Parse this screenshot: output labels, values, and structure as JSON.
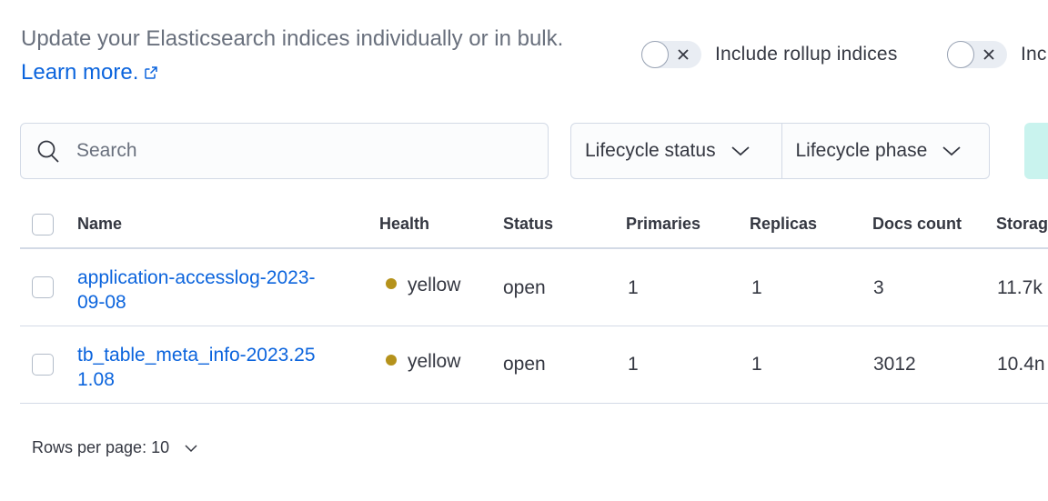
{
  "intro": {
    "text": "Update your Elasticsearch indices individually or in bulk.",
    "learn_more": "Learn more."
  },
  "toggles": [
    {
      "label": "Include rollup indices",
      "checked": false
    },
    {
      "label": "Inc",
      "checked": false
    }
  ],
  "search": {
    "placeholder": "Search",
    "value": ""
  },
  "filters": [
    {
      "label": "Lifecycle status"
    },
    {
      "label": "Lifecycle phase"
    }
  ],
  "table": {
    "columns": [
      "Name",
      "Health",
      "Status",
      "Primaries",
      "Replicas",
      "Docs count",
      "Storag"
    ],
    "rows": [
      {
        "name_line1": "application-accesslog-2023-",
        "name_line2": "09-08",
        "health": "yellow",
        "status": "open",
        "primaries": "1",
        "replicas": "1",
        "docs_count": "3",
        "storage": "11.7k"
      },
      {
        "name_line1": "tb_table_meta_info-2023.25",
        "name_line2": "1.08",
        "health": "yellow",
        "status": "open",
        "primaries": "1",
        "replicas": "1",
        "docs_count": "3012",
        "storage": "10.4n"
      }
    ]
  },
  "pagination": {
    "rows_per_page": "Rows per page: 10"
  },
  "colors": {
    "link": "#0b64dd",
    "health_yellow": "#b5921b",
    "border": "#d3dae6",
    "accent_mint": "#c9f3ee"
  }
}
